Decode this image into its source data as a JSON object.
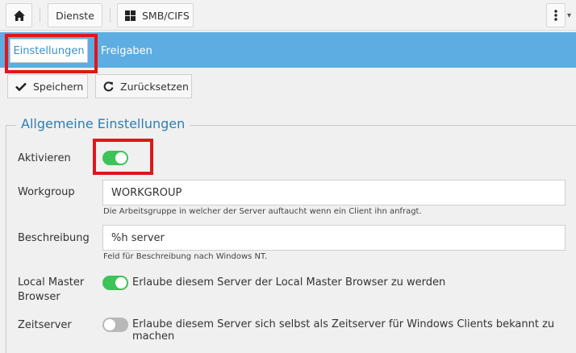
{
  "topbar": {
    "home_icon": "home-icon",
    "dienste_label": "Dienste",
    "smb_label": "SMB/CIFS",
    "smb_icon": "windows-icon",
    "more_icon": "kebab-menu-icon"
  },
  "tabs": [
    {
      "label": "Einstellungen",
      "active": true
    },
    {
      "label": "Freigaben",
      "active": false
    }
  ],
  "actions": {
    "save_label": "Speichern",
    "reset_label": "Zurücksetzen"
  },
  "section": {
    "title": "Allgemeine Einstellungen",
    "enable": {
      "label": "Aktivieren",
      "on": true
    },
    "workgroup": {
      "label": "Workgroup",
      "value": "WORKGROUP",
      "help": "Die Arbeitsgruppe in welcher der Server auftaucht wenn ein Client ihn anfragt."
    },
    "description": {
      "label": "Beschreibung",
      "value": "%h server",
      "help": "Feld für Beschreibung nach Windows NT."
    },
    "local_master": {
      "label_line1": "Local Master",
      "label_line2": "Browser",
      "on": true,
      "text": "Erlaube diesem Server der Local Master Browser zu werden"
    },
    "timeserver": {
      "label": "Zeitserver",
      "on": false,
      "text": "Erlaube diesem Server sich selbst als Zeitserver für Windows Clients bekannt zu machen"
    }
  },
  "colors": {
    "tabbar": "#5dade2",
    "highlight": "#e0161b",
    "toggle_on": "#3cc35a",
    "toggle_off": "#b8b8b8",
    "legend": "#2b7fb5"
  }
}
